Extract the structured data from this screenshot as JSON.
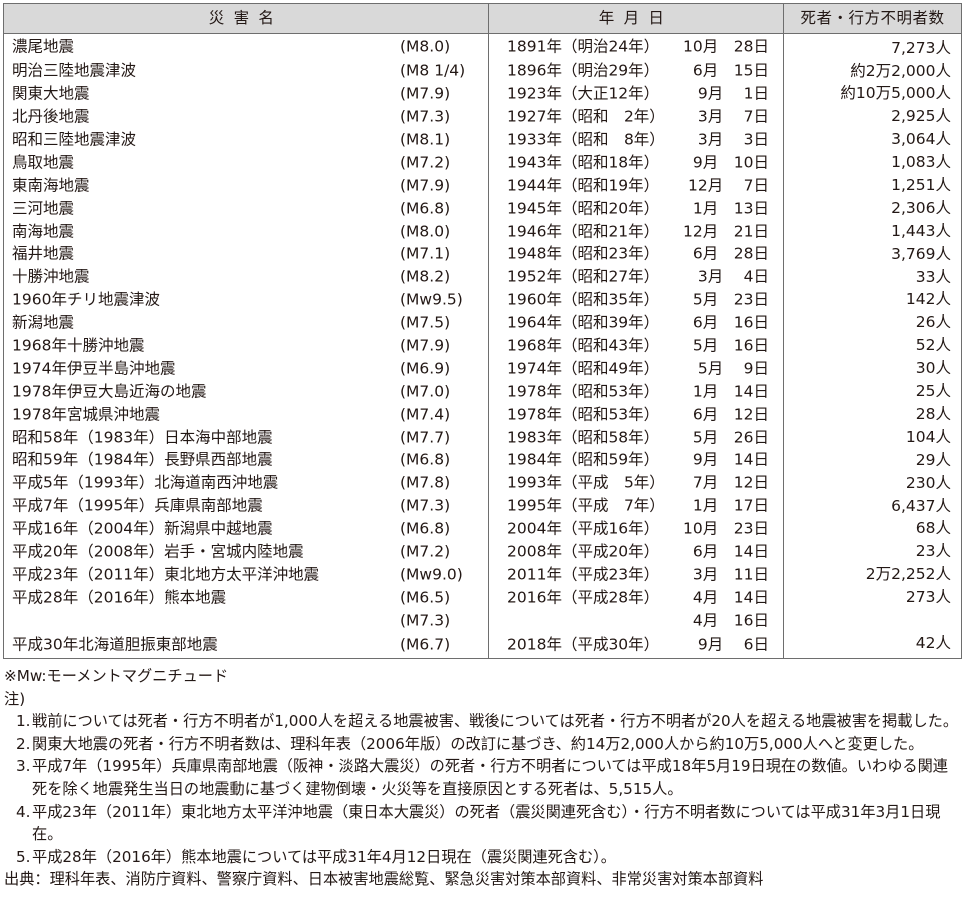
{
  "table": {
    "headers": {
      "name": "災害名",
      "date": "年月日",
      "dead": "死者・行方不明者数"
    },
    "rows": [
      {
        "name": "濃尾地震",
        "mag": "(M8.0)",
        "date": "1891年（明治24年）",
        "md": "10月　28日",
        "dead": "7,273人"
      },
      {
        "name": "明治三陸地震津波",
        "mag": "(M8 1/4)",
        "date": "1896年（明治29年）",
        "md": "6月　15日",
        "dead": "約2万2,000人"
      },
      {
        "name": "関東大地震",
        "mag": "(M7.9)",
        "date": "1923年（大正12年）",
        "md": "9月　 1日",
        "dead": "約10万5,000人"
      },
      {
        "name": "北丹後地震",
        "mag": "(M7.3)",
        "date": "1927年（昭和　2年）",
        "md": "3月　 7日",
        "dead": "2,925人"
      },
      {
        "name": "昭和三陸地震津波",
        "mag": "(M8.1)",
        "date": "1933年（昭和　8年）",
        "md": "3月　 3日",
        "dead": "3,064人"
      },
      {
        "name": "鳥取地震",
        "mag": "(M7.2)",
        "date": "1943年（昭和18年）",
        "md": "9月　10日",
        "dead": "1,083人"
      },
      {
        "name": "東南海地震",
        "mag": "(M7.9)",
        "date": "1944年（昭和19年）",
        "md": "12月　 7日",
        "dead": "1,251人"
      },
      {
        "name": "三河地震",
        "mag": "(M6.8)",
        "date": "1945年（昭和20年）",
        "md": "1月　13日",
        "dead": "2,306人"
      },
      {
        "name": "南海地震",
        "mag": "(M8.0)",
        "date": "1946年（昭和21年）",
        "md": "12月　21日",
        "dead": "1,443人"
      },
      {
        "name": "福井地震",
        "mag": "(M7.1)",
        "date": "1948年（昭和23年）",
        "md": "6月　28日",
        "dead": "3,769人"
      },
      {
        "name": "十勝沖地震",
        "mag": "(M8.2)",
        "date": "1952年（昭和27年）",
        "md": "3月　 4日",
        "dead": "33人"
      },
      {
        "name": "1960年チリ地震津波",
        "mag": "(Mw9.5)",
        "date": "1960年（昭和35年）",
        "md": "5月　23日",
        "dead": "142人"
      },
      {
        "name": "新潟地震",
        "mag": "(M7.5)",
        "date": "1964年（昭和39年）",
        "md": "6月　16日",
        "dead": "26人"
      },
      {
        "name": "1968年十勝沖地震",
        "mag": "(M7.9)",
        "date": "1968年（昭和43年）",
        "md": "5月　16日",
        "dead": "52人"
      },
      {
        "name": "1974年伊豆半島沖地震",
        "mag": "(M6.9)",
        "date": "1974年（昭和49年）",
        "md": "5月　 9日",
        "dead": "30人"
      },
      {
        "name": "1978年伊豆大島近海の地震",
        "mag": "(M7.0)",
        "date": "1978年（昭和53年）",
        "md": "1月　14日",
        "dead": "25人"
      },
      {
        "name": "1978年宮城県沖地震",
        "mag": "(M7.4)",
        "date": "1978年（昭和53年）",
        "md": "6月　12日",
        "dead": "28人"
      },
      {
        "name": "昭和58年（1983年）日本海中部地震",
        "mag": "(M7.7)",
        "date": "1983年（昭和58年）",
        "md": "5月　26日",
        "dead": "104人"
      },
      {
        "name": "昭和59年（1984年）長野県西部地震",
        "mag": "(M6.8)",
        "date": "1984年（昭和59年）",
        "md": "9月　14日",
        "dead": "29人"
      },
      {
        "name": "平成5年（1993年）北海道南西沖地震",
        "mag": "(M7.8)",
        "date": "1993年（平成　5年）",
        "md": "7月　12日",
        "dead": "230人"
      },
      {
        "name": "平成7年（1995年）兵庫県南部地震",
        "mag": "(M7.3)",
        "date": "1995年（平成　7年）",
        "md": "1月　17日",
        "dead": "6,437人"
      },
      {
        "name": "平成16年（2004年）新潟県中越地震",
        "mag": "(M6.8)",
        "date": "2004年（平成16年）",
        "md": "10月　23日",
        "dead": "68人"
      },
      {
        "name": "平成20年（2008年）岩手・宮城内陸地震",
        "mag": "(M7.2)",
        "date": "2008年（平成20年）",
        "md": "6月　14日",
        "dead": "23人"
      },
      {
        "name": "平成23年（2011年）東北地方太平洋沖地震",
        "mag": "(Mw9.0)",
        "date": "2011年（平成23年）",
        "md": "3月　11日",
        "dead": "2万2,252人"
      },
      {
        "name": "平成28年（2016年）熊本地震",
        "mag": "(M6.5)",
        "date": "2016年（平成28年）",
        "md": "4月　14日",
        "dead": "273人"
      },
      {
        "name": "",
        "mag": "(M7.3)",
        "date": "",
        "md": "4月　16日",
        "dead": ""
      },
      {
        "name": "平成30年北海道胆振東部地震",
        "mag": "(M6.7)",
        "date": "2018年（平成30年）",
        "md": "9月　 6日",
        "dead": "42人"
      }
    ]
  },
  "notes": {
    "mw_note": "※Mw:モーメントマグニチュード",
    "label": "注)",
    "items": [
      "戦前については死者・行方不明者が1,000人を超える地震被害、戦後については死者・行方不明者が20人を超える地震被害を掲載した。",
      "関東大地震の死者・行方不明者数は、理科年表（2006年版）の改訂に基づき、約14万2,000人から約10万5,000人へと変更した。",
      "平成7年（1995年）兵庫県南部地震（阪神・淡路大震災）の死者・行方不明者については平成18年5月19日現在の数値。いわゆる関連死を除く地震発生当日の地震動に基づく建物倒壊・火災等を直接原因とする死者は、5,515人。",
      "平成23年（2011年）東北地方太平洋沖地震（東日本大震災）の死者（震災関連死含む）・行方不明者数については平成31年3月1日現在。",
      "平成28年（2016年）熊本地震については平成31年4月12日現在（震災関連死含む）。"
    ],
    "source": "出典：理科年表、消防庁資料、警察庁資料、日本被害地震総覧、緊急災害対策本部資料、非常災害対策本部資料"
  }
}
